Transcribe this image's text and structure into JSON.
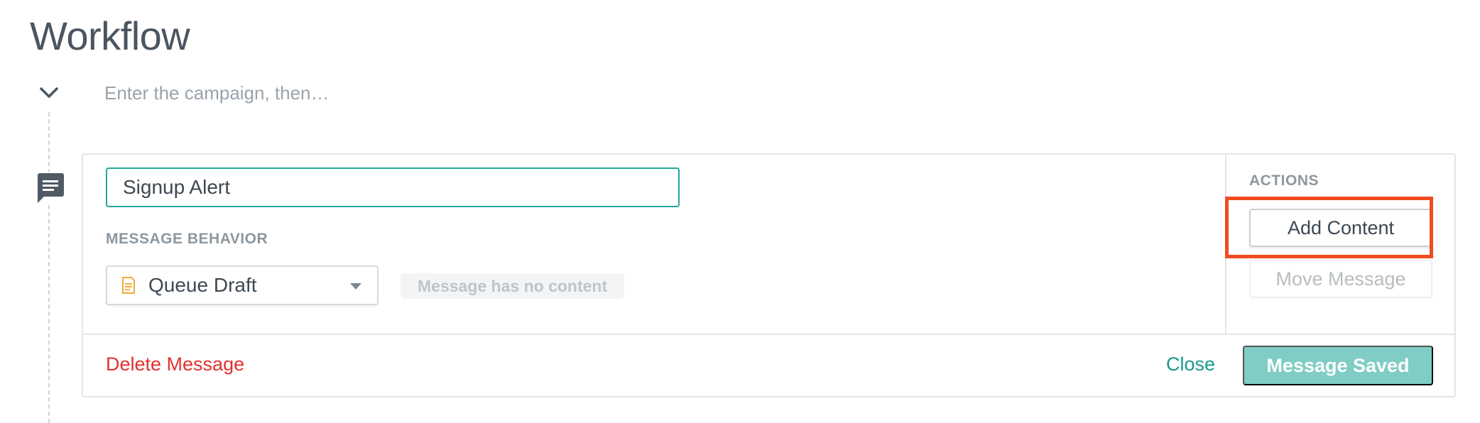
{
  "page": {
    "title": "Workflow"
  },
  "trigger": {
    "text": "Enter the campaign, then…"
  },
  "message": {
    "name_value": "Signup Alert",
    "behavior_label": "MESSAGE BEHAVIOR",
    "behavior_selected": "Queue Draft",
    "content_status": "Message has no content"
  },
  "actions": {
    "label": "ACTIONS",
    "add_content": "Add Content",
    "move_message": "Move Message"
  },
  "footer": {
    "delete": "Delete Message",
    "close": "Close",
    "saved": "Message Saved"
  },
  "colors": {
    "accent_teal": "#25a69a",
    "danger_red": "#e0322d",
    "highlight_orange": "#f24b22",
    "saved_button": "#7fcdc5",
    "draft_icon": "#f2a93b"
  },
  "icons": {
    "toggle": "chevron-down-icon",
    "message": "message-bubble-icon",
    "draft": "document-icon"
  }
}
